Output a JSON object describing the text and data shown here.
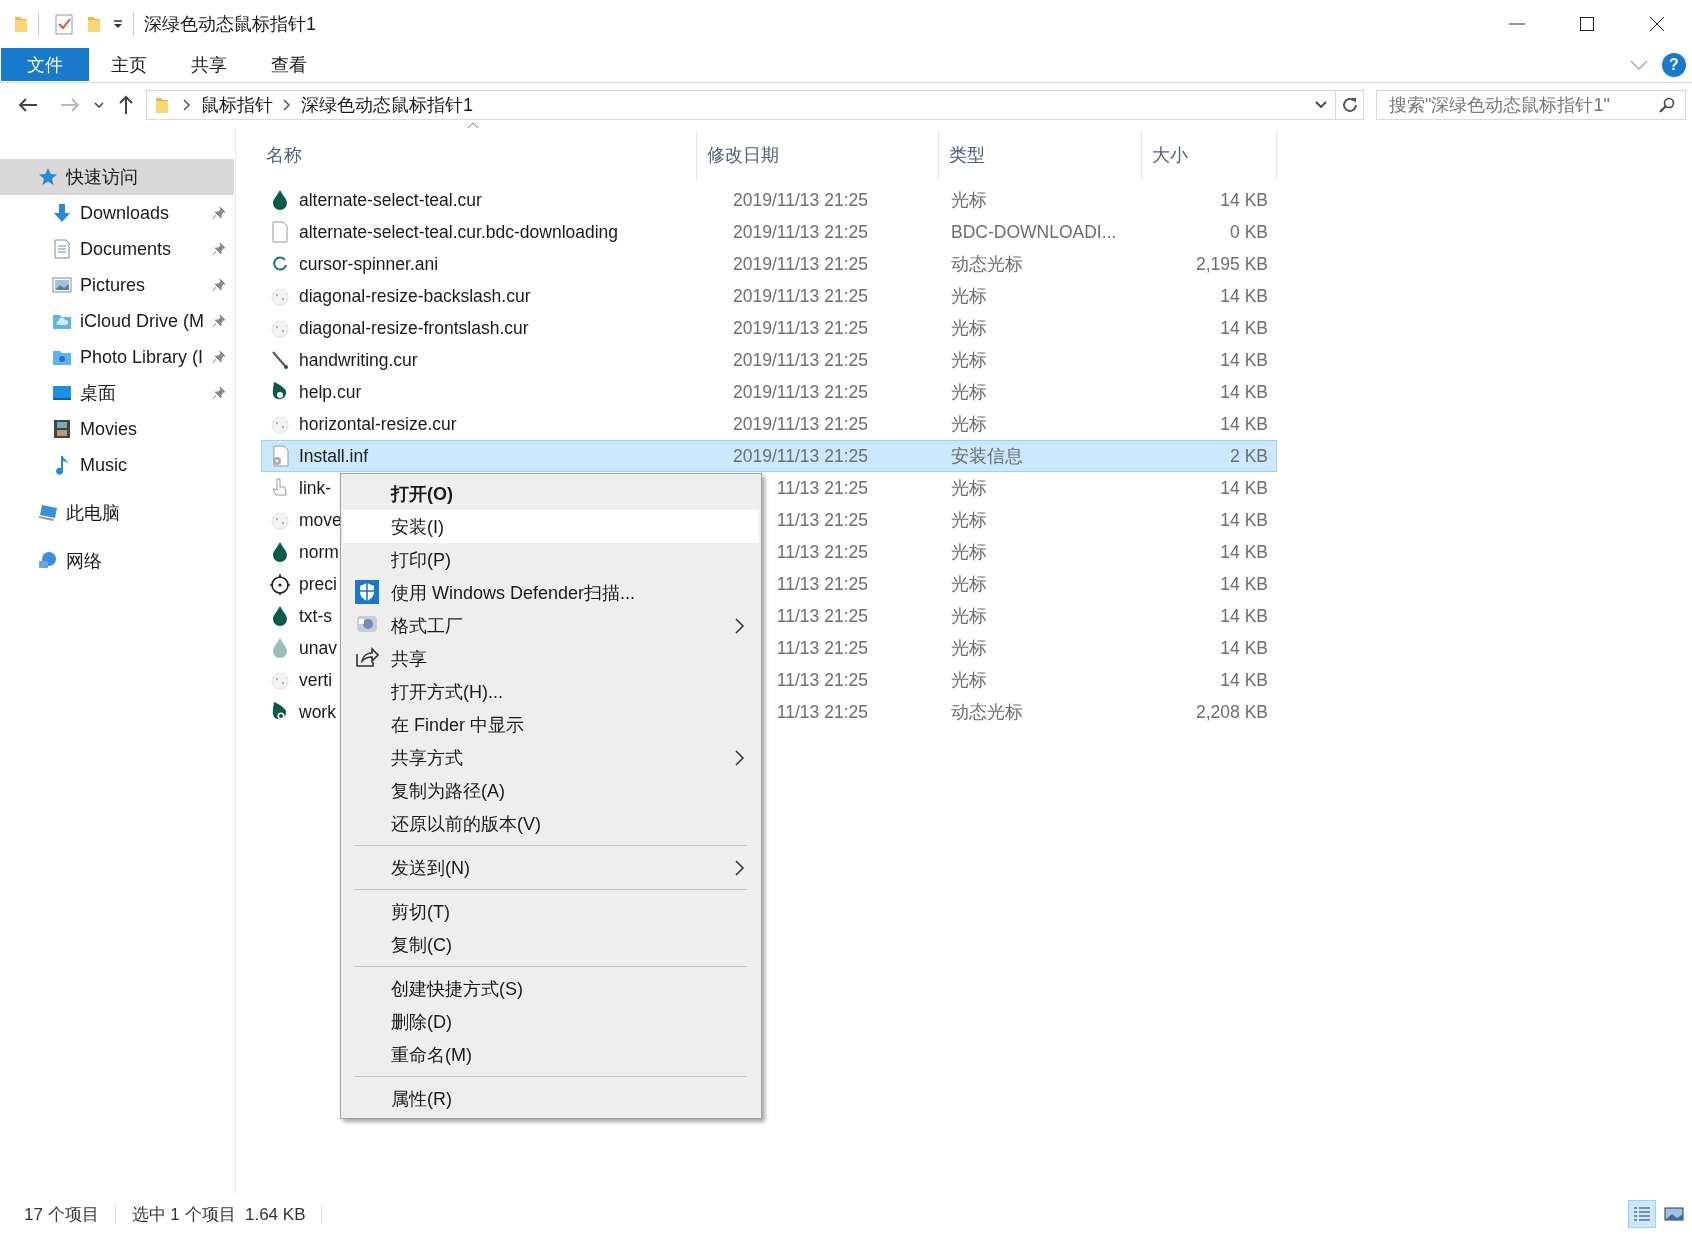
{
  "window": {
    "title": "深绿色动态鼠标指针1"
  },
  "ribbon": {
    "tabs": [
      {
        "label": "文件",
        "kind": "file",
        "selected": false
      },
      {
        "label": "主页",
        "kind": "tab",
        "selected": false
      },
      {
        "label": "共享",
        "kind": "tab",
        "selected": false
      },
      {
        "label": "查看",
        "kind": "tab",
        "selected": false
      }
    ],
    "help": "?"
  },
  "address": {
    "crumbs": [
      "鼠标指针",
      "深绿色动态鼠标指针1"
    ]
  },
  "search": {
    "placeholder": "搜索\"深绿色动态鼠标指针1\""
  },
  "sidebar": {
    "items": [
      {
        "label": "快速访问",
        "kind": "star",
        "selected": true,
        "pinned": false,
        "children": [
          {
            "label": "Downloads",
            "kind": "download",
            "selected": false,
            "pinned": true
          },
          {
            "label": "Documents",
            "kind": "document",
            "selected": false,
            "pinned": true
          },
          {
            "label": "Pictures",
            "kind": "pictures",
            "selected": false,
            "pinned": true
          },
          {
            "label": "iCloud Drive (M",
            "kind": "cloud-folder",
            "selected": false,
            "pinned": true
          },
          {
            "label": "Photo Library (I",
            "kind": "photo-folder",
            "selected": false,
            "pinned": true
          },
          {
            "label": "桌面",
            "kind": "desktop",
            "selected": false,
            "pinned": true
          },
          {
            "label": "Movies",
            "kind": "film",
            "selected": false,
            "pinned": false
          },
          {
            "label": "Music",
            "kind": "music",
            "selected": false,
            "pinned": false
          }
        ]
      },
      {
        "label": "此电脑",
        "kind": "computer",
        "selected": false,
        "pinned": false
      },
      {
        "label": "网络",
        "kind": "network",
        "selected": false,
        "pinned": false
      }
    ]
  },
  "table": {
    "columns": [
      {
        "label": "名称",
        "sorted": true
      },
      {
        "label": "修改日期",
        "sorted": false
      },
      {
        "label": "类型",
        "sorted": false
      },
      {
        "label": "大小",
        "sorted": false
      }
    ],
    "rows": [
      {
        "name": "alternate-select-teal.cur",
        "kind": "drop",
        "date": "2019/11/13 21:25",
        "type": "光标",
        "size": "14 KB",
        "selected": false
      },
      {
        "name": "alternate-select-teal.cur.bdc-downloading",
        "kind": "file",
        "date": "2019/11/13 21:25",
        "type": "BDC-DOWNLOADI...",
        "size": "0 KB",
        "selected": false
      },
      {
        "name": "cursor-spinner.ani",
        "kind": "spinner",
        "date": "2019/11/13 21:25",
        "type": "动态光标",
        "size": "2,195 KB",
        "selected": false
      },
      {
        "name": "diagonal-resize-backslash.cur",
        "kind": "faint",
        "date": "2019/11/13 21:25",
        "type": "光标",
        "size": "14 KB",
        "selected": false
      },
      {
        "name": "diagonal-resize-frontslash.cur",
        "kind": "faint",
        "date": "2019/11/13 21:25",
        "type": "光标",
        "size": "14 KB",
        "selected": false
      },
      {
        "name": "handwriting.cur",
        "kind": "pen",
        "date": "2019/11/13 21:25",
        "type": "光标",
        "size": "14 KB",
        "selected": false
      },
      {
        "name": "help.cur",
        "kind": "help",
        "date": "2019/11/13 21:25",
        "type": "光标",
        "size": "14 KB",
        "selected": false
      },
      {
        "name": "horizontal-resize.cur",
        "kind": "faint",
        "date": "2019/11/13 21:25",
        "type": "光标",
        "size": "14 KB",
        "selected": false
      },
      {
        "name": "Install.inf",
        "kind": "inf",
        "date": "2019/11/13 21:25",
        "type": "安装信息",
        "size": "2 KB",
        "selected": true
      },
      {
        "name": "link-",
        "kind": "hand",
        "date": "11/13 21:25",
        "type": "光标",
        "size": "14 KB",
        "selected": false
      },
      {
        "name": "move",
        "kind": "faint",
        "date": "11/13 21:25",
        "type": "光标",
        "size": "14 KB",
        "selected": false
      },
      {
        "name": "norm",
        "kind": "drop",
        "date": "11/13 21:25",
        "type": "光标",
        "size": "14 KB",
        "selected": false
      },
      {
        "name": "preci",
        "kind": "target",
        "date": "11/13 21:25",
        "type": "光标",
        "size": "14 KB",
        "selected": false
      },
      {
        "name": "txt-s",
        "kind": "drop",
        "date": "11/13 21:25",
        "type": "光标",
        "size": "14 KB",
        "selected": false
      },
      {
        "name": "unav",
        "kind": "pale",
        "date": "11/13 21:25",
        "type": "光标",
        "size": "14 KB",
        "selected": false
      },
      {
        "name": "verti",
        "kind": "faint",
        "date": "11/13 21:25",
        "type": "光标",
        "size": "14 KB",
        "selected": false
      },
      {
        "name": "work",
        "kind": "busy",
        "date": "11/13 21:25",
        "type": "动态光标",
        "size": "2,208 KB",
        "selected": false
      }
    ]
  },
  "context_menu": {
    "groups": [
      [
        {
          "label": "打开(O)",
          "kind": "plain",
          "default": true,
          "selected": false,
          "submenu": false
        },
        {
          "label": "安装(I)",
          "kind": "plain",
          "default": false,
          "selected": true,
          "submenu": false
        },
        {
          "label": "打印(P)",
          "kind": "plain",
          "default": false,
          "selected": false,
          "submenu": false
        },
        {
          "label": "使用 Windows Defender扫描...",
          "kind": "shield",
          "default": false,
          "selected": false,
          "submenu": false
        },
        {
          "label": "格式工厂",
          "kind": "app",
          "default": false,
          "selected": false,
          "submenu": true
        },
        {
          "label": "共享",
          "kind": "share",
          "default": false,
          "selected": false,
          "submenu": false
        },
        {
          "label": "打开方式(H)...",
          "kind": "plain",
          "default": false,
          "selected": false,
          "submenu": false
        },
        {
          "label": "在 Finder 中显示",
          "kind": "plain",
          "default": false,
          "selected": false,
          "submenu": false
        },
        {
          "label": "共享方式",
          "kind": "plain",
          "default": false,
          "selected": false,
          "submenu": true
        },
        {
          "label": "复制为路径(A)",
          "kind": "plain",
          "default": false,
          "selected": false,
          "submenu": false
        },
        {
          "label": "还原以前的版本(V)",
          "kind": "plain",
          "default": false,
          "selected": false,
          "submenu": false
        }
      ],
      [
        {
          "label": "发送到(N)",
          "kind": "plain",
          "default": false,
          "selected": false,
          "submenu": true
        }
      ],
      [
        {
          "label": "剪切(T)",
          "kind": "plain",
          "default": false,
          "selected": false,
          "submenu": false
        },
        {
          "label": "复制(C)",
          "kind": "plain",
          "default": false,
          "selected": false,
          "submenu": false
        }
      ],
      [
        {
          "label": "创建快捷方式(S)",
          "kind": "plain",
          "default": false,
          "selected": false,
          "submenu": false
        },
        {
          "label": "删除(D)",
          "kind": "plain",
          "default": false,
          "selected": false,
          "submenu": false
        },
        {
          "label": "重命名(M)",
          "kind": "plain",
          "default": false,
          "selected": false,
          "submenu": false
        }
      ],
      [
        {
          "label": "属性(R)",
          "kind": "plain",
          "default": false,
          "selected": false,
          "submenu": false
        }
      ]
    ]
  },
  "status_bar": {
    "count": "17 个项目",
    "selection": "选中 1 个项目  1.64 KB",
    "views": [
      {
        "kind": "details",
        "selected": true
      },
      {
        "kind": "large-icons",
        "selected": false
      }
    ]
  }
}
